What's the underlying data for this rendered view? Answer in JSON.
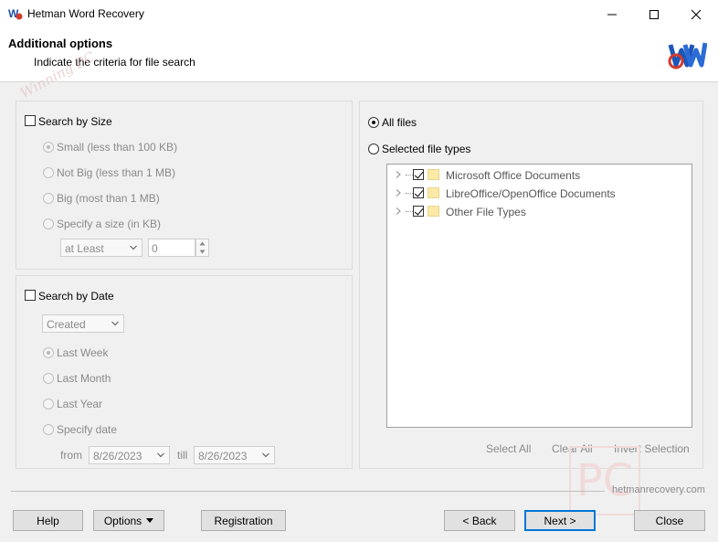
{
  "window": {
    "title": "Hetman Word Recovery"
  },
  "header": {
    "title": "Additional options",
    "subtitle": "Indicate the criteria for file search",
    "watermark": "Winning PC"
  },
  "size_panel": {
    "checkbox_label": "Search by Size",
    "options": [
      "Small (less than 100 KB)",
      "Not Big (less than 1 MB)",
      "Big (most than 1 MB)",
      "Specify a size (in KB)"
    ],
    "comparison": "at Least",
    "size_value": "0"
  },
  "date_panel": {
    "checkbox_label": "Search by Date",
    "date_type": "Created",
    "options": [
      "Last Week",
      "Last Month",
      "Last Year",
      "Specify date"
    ],
    "from_label": "from",
    "from_value": "8/26/2023",
    "till_label": "till",
    "till_value": "8/26/2023"
  },
  "types_panel": {
    "all_files_label": "All files",
    "selected_types_label": "Selected file types",
    "tree": [
      "Microsoft Office Documents",
      "LibreOffice/OpenOffice Documents",
      "Other File Types"
    ],
    "select_all": "Select All",
    "clear_all": "Clear All",
    "invert": "Invert Selection"
  },
  "footer": {
    "site": "hetmanrecovery.com",
    "help": "Help",
    "options": "Options",
    "registration": "Registration",
    "back": "< Back",
    "next": "Next >",
    "close": "Close",
    "pc_watermark": "PC"
  },
  "colors": {
    "accent": "#0078d7",
    "disabled_text": "#8a8a8a",
    "folder": "#fbe9a6"
  }
}
